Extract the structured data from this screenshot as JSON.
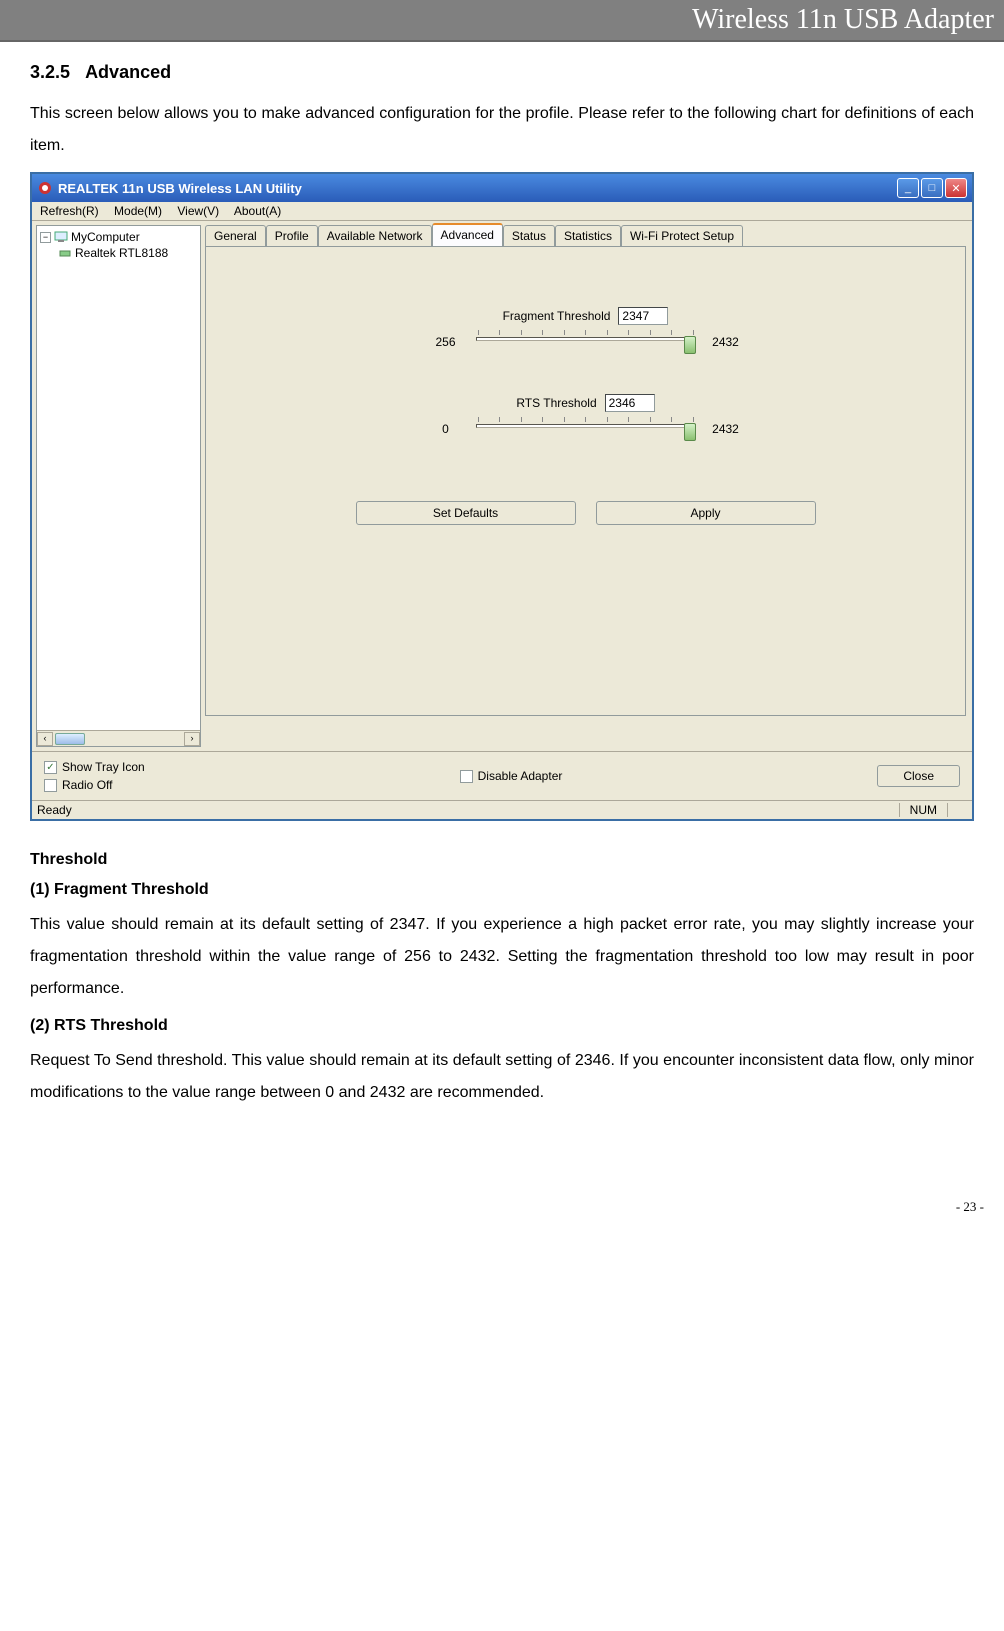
{
  "header": "Wireless 11n USB Adapter",
  "section": {
    "number": "3.2.5",
    "title": "Advanced",
    "intro": "This screen below allows you to make advanced configuration for the profile. Please refer to the following chart for definitions of each item."
  },
  "app": {
    "title": "REALTEK 11n USB Wireless LAN Utility",
    "menu": {
      "refresh": "Refresh(R)",
      "mode": "Mode(M)",
      "view": "View(V)",
      "about": "About(A)"
    },
    "tree": {
      "root": "MyComputer",
      "child": "Realtek RTL8188"
    },
    "tabs": [
      "General",
      "Profile",
      "Available Network",
      "Advanced",
      "Status",
      "Statistics",
      "Wi-Fi Protect Setup"
    ],
    "active_tab": "Advanced",
    "fragment": {
      "label": "Fragment Threshold",
      "value": "2347",
      "min": "256",
      "max": "2432"
    },
    "rts": {
      "label": "RTS Threshold",
      "value": "2346",
      "min": "0",
      "max": "2432"
    },
    "buttons": {
      "defaults": "Set Defaults",
      "apply": "Apply"
    },
    "footer": {
      "show_tray": "Show Tray Icon",
      "radio_off": "Radio Off",
      "disable": "Disable Adapter",
      "close": "Close"
    },
    "status": {
      "ready": "Ready",
      "num": "NUM"
    }
  },
  "doc": {
    "threshold_heading": "Threshold",
    "frag_heading": "(1) Fragment Threshold",
    "frag_text": "This value should remain at its default setting of 2347. If you experience a high packet error rate, you may slightly increase your fragmentation threshold within the value range of 256 to 2432. Setting the fragmentation threshold too low may result in poor performance.",
    "rts_heading": "(2) RTS Threshold",
    "rts_text": "Request To Send threshold. This value should remain at its default setting of 2346. If you encounter inconsistent data flow, only minor modifications to the value range between 0 and 2432 are recommended."
  },
  "page_number": "- 23 -"
}
